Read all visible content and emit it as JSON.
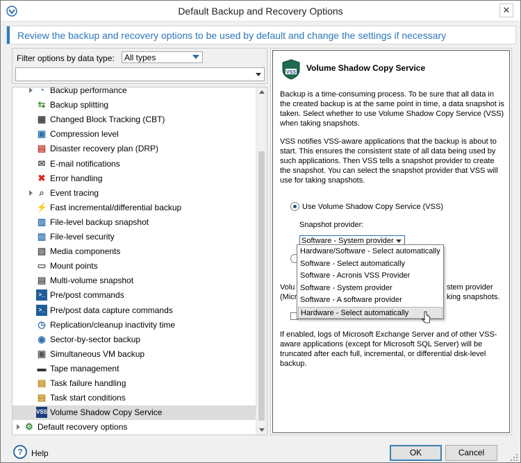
{
  "window": {
    "title": "Default Backup and Recovery Options",
    "close_glyph": "✕"
  },
  "header": {
    "text": "Review the backup and recovery options to be used by default and change the settings if necessary"
  },
  "filter": {
    "label": "Filter options by data type:",
    "selected": "All types",
    "search_value": ""
  },
  "tree": {
    "items": [
      {
        "label": "Backup performance",
        "icon": "gauge-icon"
      },
      {
        "label": "Backup splitting",
        "icon": "split-icon"
      },
      {
        "label": "Changed Block Tracking (CBT)",
        "icon": "blocks-icon"
      },
      {
        "label": "Compression level",
        "icon": "compress-icon"
      },
      {
        "label": "Disaster recovery plan (DRP)",
        "icon": "document-icon"
      },
      {
        "label": "E-mail notifications",
        "icon": "envelope-icon"
      },
      {
        "label": "Error handling",
        "icon": "error-icon"
      },
      {
        "label": "Event tracing",
        "icon": "magnifier-icon"
      },
      {
        "label": "Fast incremental/differential backup",
        "icon": "lightning-icon"
      },
      {
        "label": "File-level backup snapshot",
        "icon": "file-icon"
      },
      {
        "label": "File-level security",
        "icon": "lock-file-icon"
      },
      {
        "label": "Media components",
        "icon": "media-icon"
      },
      {
        "label": "Mount points",
        "icon": "mount-icon"
      },
      {
        "label": "Multi-volume snapshot",
        "icon": "volumes-icon"
      },
      {
        "label": "Pre/post commands",
        "icon": "terminal-icon"
      },
      {
        "label": "Pre/post data capture commands",
        "icon": "terminal-icon"
      },
      {
        "label": "Replication/cleanup inactivity time",
        "icon": "clock-icon"
      },
      {
        "label": "Sector-by-sector backup",
        "icon": "disk-icon"
      },
      {
        "label": "Simultaneous VM backup",
        "icon": "vm-icon"
      },
      {
        "label": "Tape management",
        "icon": "tape-icon"
      },
      {
        "label": "Task failure handling",
        "icon": "task-icon"
      },
      {
        "label": "Task start conditions",
        "icon": "task-icon"
      },
      {
        "label": "Volume Shadow Copy Service",
        "icon": "vss-icon"
      }
    ],
    "root_item": {
      "label": "Default recovery options",
      "icon": "gear-globe-icon"
    }
  },
  "detail": {
    "title": "Volume Shadow Copy Service",
    "icon_text": "VSS",
    "para1": "Backup is a time-consuming process. To be sure that all data in the created backup is at the same point in time, a data snapshot is taken. Select whether to use Volume Shadow Copy Service (VSS) when taking snapshots.",
    "para2": "VSS notifies VSS-aware applications that the backup is about to start. This ensures the consistent state of all data being used by such applications. Then VSS tells a snapshot provider to create the snapshot. You can select the snapshot provider that VSS will use for taking snapshots.",
    "radio_use_vss": "Use Volume Shadow Copy Service (VSS)",
    "provider_label": "Snapshot provider:",
    "provider_selected": "Software - System provider",
    "partial_text_1_left": "Volu",
    "partial_text_1_right": "stem provider",
    "partial_text_2_left": "(Micr",
    "partial_text_2_right": "king snapshots.",
    "para3": "If enabled, logs of Microsoft Exchange Server and of other VSS-aware applications (except for Microsoft SQL Server) will be truncated after each full, incremental, or differential disk-level backup."
  },
  "dropdown": {
    "options": [
      "Hardware/Software - Select automatically",
      "Software - Select automatically",
      "Software - Acronis VSS Provider",
      "Software - System provider",
      "Software - A software provider",
      "Hardware - Select automatically"
    ],
    "hovered_index": 5
  },
  "footer": {
    "help_glyph": "?",
    "help_label": "Help",
    "ok_label": "OK",
    "cancel_label": "Cancel"
  },
  "colors": {
    "accent": "#2f7bbd",
    "header_text": "#2d77b9",
    "selected_row": "#dcdcdc"
  }
}
